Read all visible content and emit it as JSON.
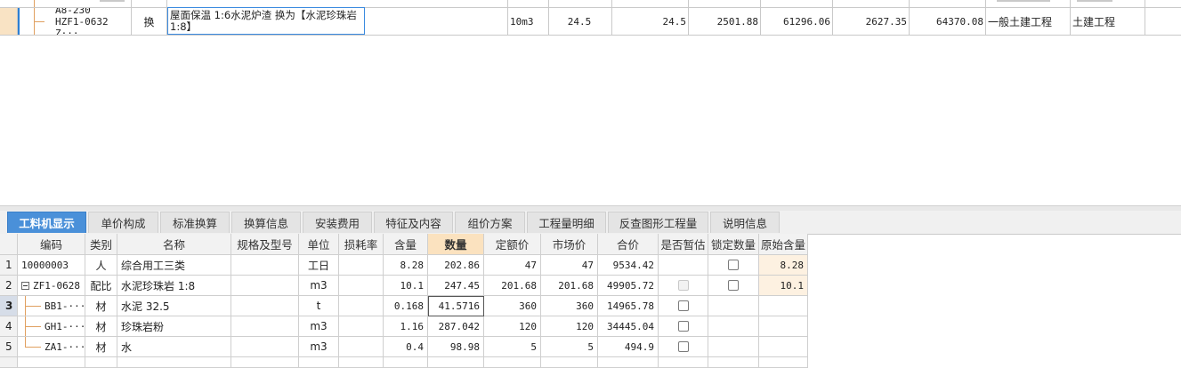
{
  "quota_row": {
    "code_top": "A8-230",
    "code_bottom": "HZF1-0632 Z···",
    "type": "换",
    "name": "屋面保温 1:6水泥炉渣  换为【水泥珍珠岩 1:8】",
    "unit": "10m3",
    "qty_expr": "24.5",
    "qty": "24.5",
    "unit_price": "2501.88",
    "total": "61296.06",
    "market_price": "2627.35",
    "market_total": "64370.08",
    "major": "一般土建工程",
    "category": "土建工程"
  },
  "tabs": [
    "工料机显示",
    "单价构成",
    "标准换算",
    "换算信息",
    "安装费用",
    "特征及内容",
    "组价方案",
    "工程量明细",
    "反查图形工程量",
    "说明信息"
  ],
  "active_tab": "工料机显示",
  "columns": [
    "编码",
    "类别",
    "名称",
    "规格及型号",
    "单位",
    "损耗率",
    "含量",
    "数量",
    "定额价",
    "市场价",
    "合价",
    "是否暂估",
    "锁定数量",
    "原始含量"
  ],
  "rows": [
    {
      "no": "1",
      "code": "10000003",
      "type": "人",
      "name": "综合用工三类",
      "spec": "",
      "unit": "工日",
      "loss": "",
      "content": "8.28",
      "qty": "202.86",
      "quota_price": "47",
      "market_price": "47",
      "total": "9534.42",
      "estimate": false,
      "lock": true,
      "orig": "8.28"
    },
    {
      "no": "2",
      "code": "ZF1-0628",
      "type": "配比",
      "name": "水泥珍珠岩 1:8",
      "spec": "",
      "unit": "m3",
      "loss": "",
      "content": "10.1",
      "qty": "247.45",
      "quota_price": "201.68",
      "market_price": "201.68",
      "total": "49905.72",
      "estimate": true,
      "lock": true,
      "orig": "10.1"
    },
    {
      "no": "3",
      "code": "BB1-···",
      "type": "材",
      "name": "水泥 32.5",
      "spec": "",
      "unit": "t",
      "loss": "",
      "content": "0.168",
      "qty": "41.5716",
      "quota_price": "360",
      "market_price": "360",
      "total": "14965.78",
      "estimate": true,
      "lock": false,
      "orig": ""
    },
    {
      "no": "4",
      "code": "GH1-···",
      "type": "材",
      "name": "珍珠岩粉",
      "spec": "",
      "unit": "m3",
      "loss": "",
      "content": "1.16",
      "qty": "287.042",
      "quota_price": "120",
      "market_price": "120",
      "total": "34445.04",
      "estimate": true,
      "lock": false,
      "orig": ""
    },
    {
      "no": "5",
      "code": "ZA1-···",
      "type": "材",
      "name": "水",
      "spec": "",
      "unit": "m3",
      "loss": "",
      "content": "0.4",
      "qty": "98.98",
      "quota_price": "5",
      "market_price": "5",
      "total": "494.9",
      "estimate": true,
      "lock": false,
      "orig": ""
    }
  ]
}
